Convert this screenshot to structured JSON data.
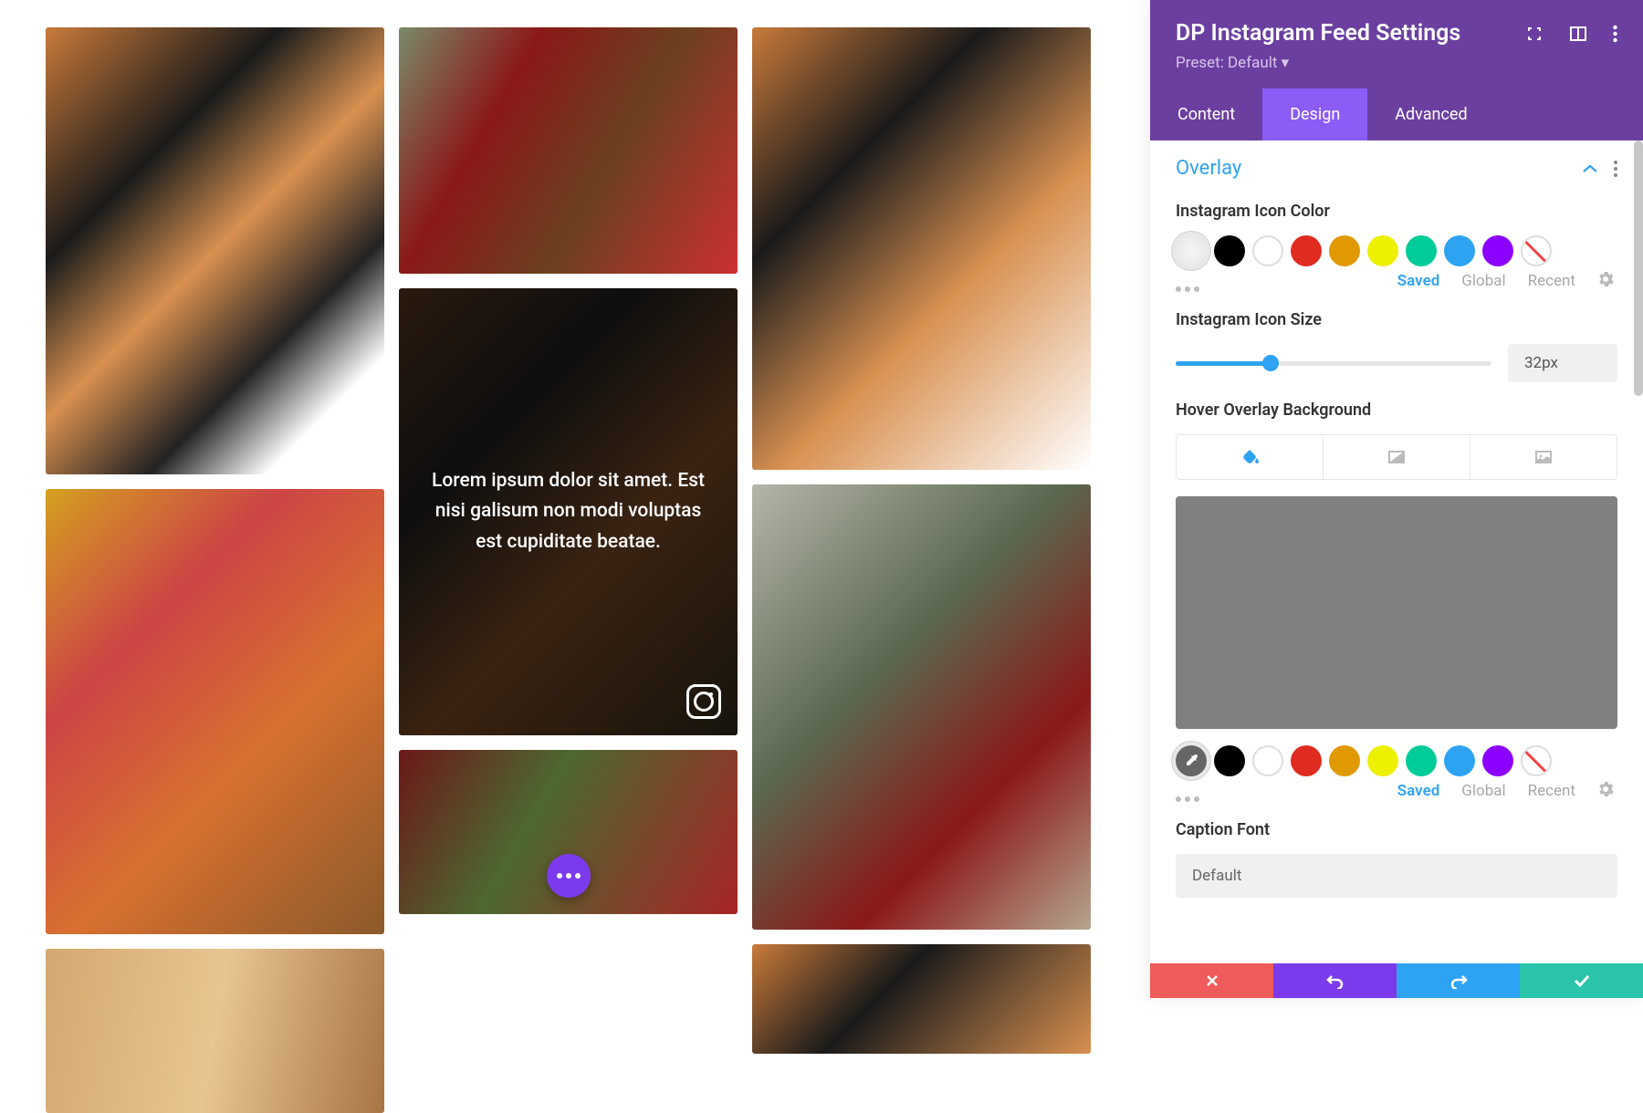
{
  "header": {
    "title": "DP Instagram Feed Settings",
    "preset": "Preset: Default ▾"
  },
  "tabs": {
    "content": "Content",
    "design": "Design",
    "advanced": "Advanced"
  },
  "section": {
    "title": "Overlay"
  },
  "fields": {
    "iconColor": "Instagram Icon Color",
    "iconSize": "Instagram Icon Size",
    "iconSizeValue": "32px",
    "hoverBg": "Hover Overlay Background",
    "captionFont": "Caption Font",
    "captionFontValue": "Default"
  },
  "paletteLinks": {
    "saved": "Saved",
    "global": "Global",
    "recent": "Recent"
  },
  "swatchColors": {
    "black": "#000000",
    "red": "#e02b20",
    "orange": "#e09900",
    "yellow": "#edf000",
    "green": "#0c9",
    "blue": "#2ea3f2",
    "purple": "#8b00ff"
  },
  "overlayCaption": "Lorem ipsum dolor sit amet. Est nisi galisum non modi voluptas est cupiditate beatae."
}
